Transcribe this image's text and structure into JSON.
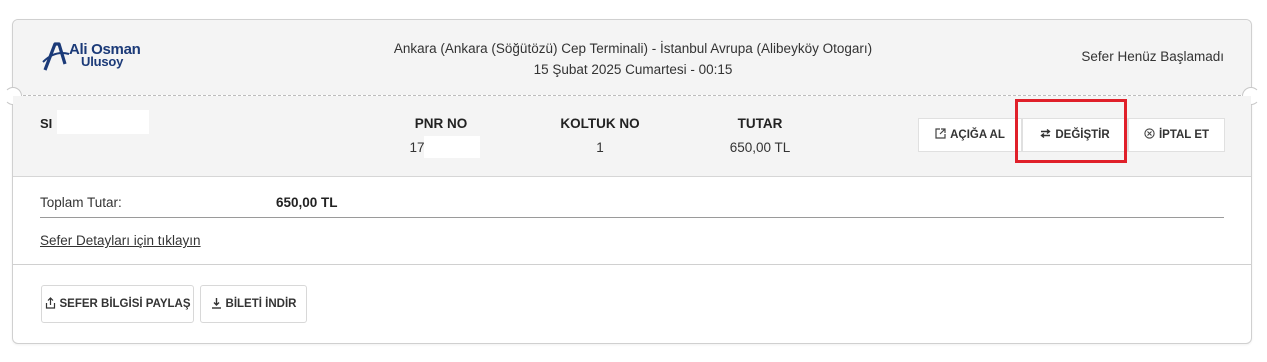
{
  "header": {
    "logo_line1": "Ali Osman",
    "logo_line2": "Ulusoy",
    "route": "Ankara (Ankara (Söğütözü) Cep Terminali) - İstanbul Avrupa (Alibeyköy Otogarı)",
    "datetime": "15 Şubat 2025 Cumartesi - 00:15",
    "status": "Sefer Henüz Başlamadı"
  },
  "ticket": {
    "passenger_prefix": "SI",
    "pnr_label": "PNR NO",
    "pnr_value": "17",
    "seat_label": "KOLTUK NO",
    "seat_value": "1",
    "amount_label": "TUTAR",
    "amount_value": "650,00 TL"
  },
  "actions": {
    "open_label": "AÇIĞA AL",
    "change_label": "DEĞİŞTİR",
    "cancel_label": "İPTAL ET"
  },
  "summary": {
    "total_label": "Toplam Tutar:",
    "total_value": "650,00 TL",
    "details_link": "Sefer Detayları için tıklayın"
  },
  "footer": {
    "share_label": "SEFER BİLGİSİ PAYLAŞ",
    "download_label": "BİLETİ İNDİR"
  },
  "icons": {
    "open": "external-link-icon",
    "change": "swap-arrows-icon",
    "cancel": "circle-x-icon",
    "share": "share-icon",
    "download": "download-icon"
  },
  "colors": {
    "highlight": "#e0202a",
    "brand": "#1b3a78"
  }
}
